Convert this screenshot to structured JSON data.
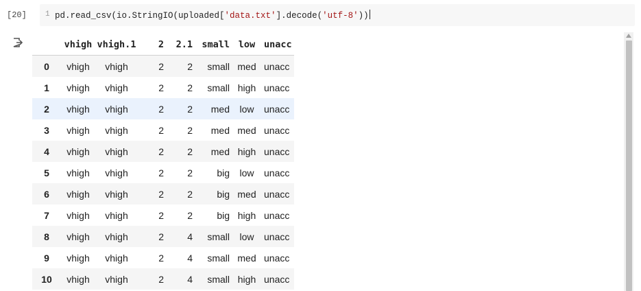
{
  "cell": {
    "exec_count": "[20]",
    "line_number": "1",
    "code_before": "pd.read_csv(io.StringIO(uploaded[",
    "code_str1": "'data.txt'",
    "code_mid": "].decode(",
    "code_str2": "'utf-8'",
    "code_after": "))"
  },
  "output": {
    "icon": "output-redirect-icon",
    "columns": [
      "",
      "vhigh",
      "vhigh.1",
      "2",
      "2.1",
      "small",
      "low",
      "unacc"
    ],
    "rows": [
      [
        "0",
        "vhigh",
        "vhigh",
        "2",
        "2",
        "small",
        "med",
        "unacc"
      ],
      [
        "1",
        "vhigh",
        "vhigh",
        "2",
        "2",
        "small",
        "high",
        "unacc"
      ],
      [
        "2",
        "vhigh",
        "vhigh",
        "2",
        "2",
        "med",
        "low",
        "unacc"
      ],
      [
        "3",
        "vhigh",
        "vhigh",
        "2",
        "2",
        "med",
        "med",
        "unacc"
      ],
      [
        "4",
        "vhigh",
        "vhigh",
        "2",
        "2",
        "med",
        "high",
        "unacc"
      ],
      [
        "5",
        "vhigh",
        "vhigh",
        "2",
        "2",
        "big",
        "low",
        "unacc"
      ],
      [
        "6",
        "vhigh",
        "vhigh",
        "2",
        "2",
        "big",
        "med",
        "unacc"
      ],
      [
        "7",
        "vhigh",
        "vhigh",
        "2",
        "2",
        "big",
        "high",
        "unacc"
      ],
      [
        "8",
        "vhigh",
        "vhigh",
        "2",
        "4",
        "small",
        "low",
        "unacc"
      ],
      [
        "9",
        "vhigh",
        "vhigh",
        "2",
        "4",
        "small",
        "med",
        "unacc"
      ],
      [
        "10",
        "vhigh",
        "vhigh",
        "2",
        "4",
        "small",
        "high",
        "unacc"
      ]
    ],
    "highlighted_row": 2
  },
  "colors": {
    "highlight": "#eaf2fd",
    "stripe": "#f5f5f5",
    "string": "#a31515"
  }
}
